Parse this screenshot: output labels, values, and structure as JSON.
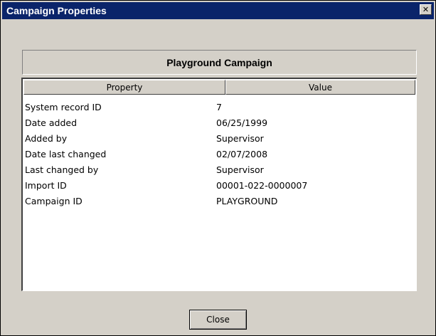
{
  "window": {
    "title": "Campaign Properties",
    "close_glyph": "✕"
  },
  "header": {
    "record_name": "Playground Campaign"
  },
  "list": {
    "columns": {
      "property": "Property",
      "value": "Value"
    },
    "rows": [
      {
        "property": "System record ID",
        "value": "7"
      },
      {
        "property": "Date added",
        "value": "06/25/1999"
      },
      {
        "property": "Added by",
        "value": "Supervisor"
      },
      {
        "property": "Date last changed",
        "value": "02/07/2008"
      },
      {
        "property": "Last changed by",
        "value": "Supervisor"
      },
      {
        "property": "Import ID",
        "value": "00001-022-0000007"
      },
      {
        "property": "Campaign ID",
        "value": "PLAYGROUND"
      }
    ]
  },
  "footer": {
    "close_label": "Close"
  },
  "colors": {
    "title_bar": "#0a246a",
    "dialog_face": "#d4d0c8"
  }
}
